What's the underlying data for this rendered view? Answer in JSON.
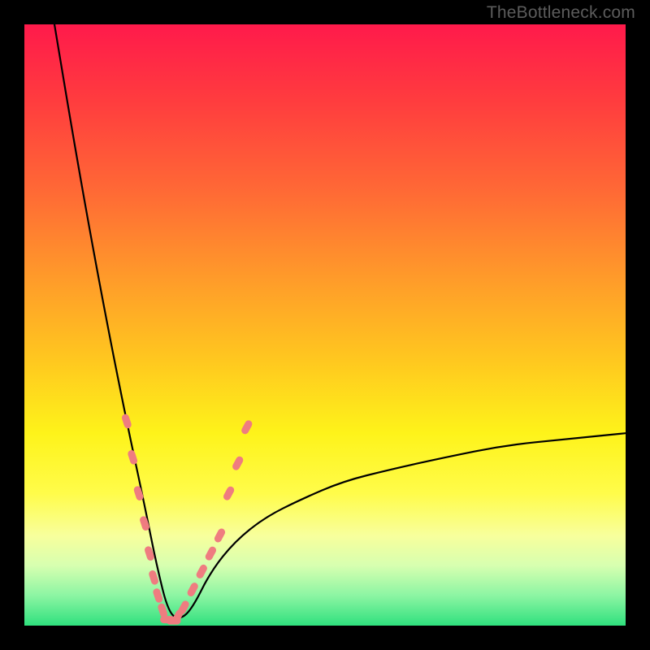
{
  "watermark": "TheBottleneck.com",
  "chart_data": {
    "type": "line",
    "title": "",
    "xlabel": "",
    "ylabel": "",
    "xlim": [
      0,
      100
    ],
    "ylim": [
      0,
      100
    ],
    "grid": false,
    "legend": false,
    "description": "V-shaped bottleneck curve plotted over a vertical rainbow gradient (red at top through yellow to green at bottom). The curve plunges from near 100% at x≈5, reaches a minimum of ~0% around x≈24, then rises toward ~32% at x=100. Salmon-colored dashed marker segments decorate the two inner flanks of the V near the bottom.",
    "series": [
      {
        "name": "bottleneck-curve",
        "x": [
          5,
          8,
          11,
          14,
          17,
          20,
          22,
          24,
          26,
          28,
          31,
          35,
          40,
          46,
          53,
          61,
          70,
          80,
          90,
          100
        ],
        "y": [
          100,
          82,
          65,
          49,
          34,
          20,
          10,
          2,
          1,
          3,
          9,
          14,
          18,
          21,
          24,
          26,
          28,
          30,
          31,
          32
        ]
      }
    ],
    "markers": {
      "color": "#ef7c80",
      "left_flank": [
        {
          "x": 17.0,
          "y": 34
        },
        {
          "x": 18.0,
          "y": 28
        },
        {
          "x": 19.0,
          "y": 22
        },
        {
          "x": 20.0,
          "y": 17
        },
        {
          "x": 20.8,
          "y": 12
        },
        {
          "x": 21.5,
          "y": 8
        },
        {
          "x": 22.2,
          "y": 5
        },
        {
          "x": 23.0,
          "y": 2.5
        }
      ],
      "right_flank": [
        {
          "x": 25.5,
          "y": 1.5
        },
        {
          "x": 26.5,
          "y": 3
        },
        {
          "x": 28.0,
          "y": 6
        },
        {
          "x": 29.5,
          "y": 9
        },
        {
          "x": 31.0,
          "y": 12
        },
        {
          "x": 32.5,
          "y": 15
        },
        {
          "x": 34.0,
          "y": 22
        },
        {
          "x": 35.5,
          "y": 27
        },
        {
          "x": 37.0,
          "y": 33
        }
      ],
      "bottom": [
        {
          "x": 23.8,
          "y": 1
        },
        {
          "x": 24.8,
          "y": 0.8
        }
      ]
    },
    "gradient_stops": [
      {
        "pos": 0,
        "color": "#ff1a4b"
      },
      {
        "pos": 12,
        "color": "#ff3a3f"
      },
      {
        "pos": 28,
        "color": "#ff6a35"
      },
      {
        "pos": 42,
        "color": "#ff9a2a"
      },
      {
        "pos": 56,
        "color": "#ffc81f"
      },
      {
        "pos": 68,
        "color": "#fef31a"
      },
      {
        "pos": 78,
        "color": "#fffc4a"
      },
      {
        "pos": 85,
        "color": "#f8ff9c"
      },
      {
        "pos": 90,
        "color": "#d7ffb0"
      },
      {
        "pos": 95,
        "color": "#8cf5a3"
      },
      {
        "pos": 100,
        "color": "#2fe07e"
      }
    ]
  }
}
